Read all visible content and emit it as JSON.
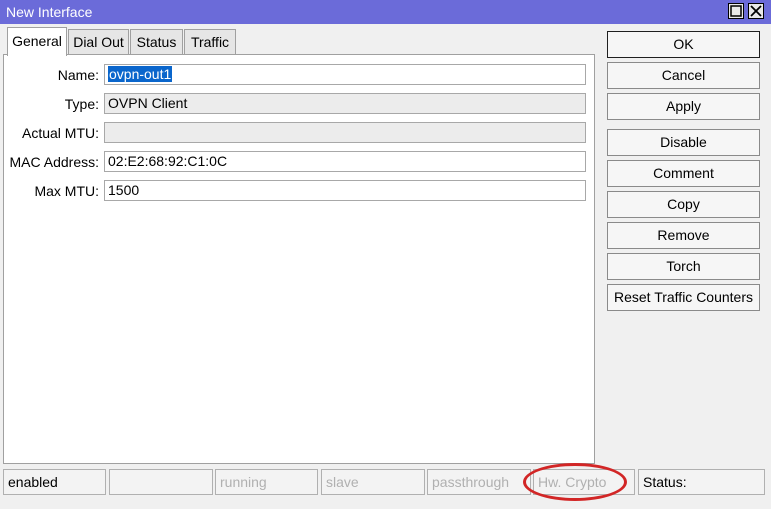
{
  "window": {
    "title": "New Interface",
    "maximize_icon": "maximize-icon",
    "close_icon": "close-icon"
  },
  "tabs": [
    {
      "label": "General",
      "active": true
    },
    {
      "label": "Dial Out",
      "active": false
    },
    {
      "label": "Status",
      "active": false
    },
    {
      "label": "Traffic",
      "active": false
    }
  ],
  "form": {
    "name": {
      "label": "Name:",
      "value": "ovpn-out1"
    },
    "type": {
      "label": "Type:",
      "value": "OVPN Client"
    },
    "actual_mtu": {
      "label": "Actual MTU:",
      "value": ""
    },
    "mac_address": {
      "label": "MAC Address:",
      "value": "02:E2:68:92:C1:0C"
    },
    "max_mtu": {
      "label": "Max MTU:",
      "value": "1500"
    }
  },
  "buttons": {
    "ok": "OK",
    "cancel": "Cancel",
    "apply": "Apply",
    "disable": "Disable",
    "comment": "Comment",
    "copy": "Copy",
    "remove": "Remove",
    "torch": "Torch",
    "reset_traffic_counters": "Reset Traffic Counters"
  },
  "statusbar": {
    "enabled": "enabled",
    "blank": "",
    "running": "running",
    "slave": "slave",
    "passthrough": "passthrough",
    "hw_crypto": "Hw. Crypto",
    "status": "Status:"
  },
  "colors": {
    "titlebar": "#6b6bd9",
    "selection": "#0a66cc",
    "annotation": "#d22626"
  }
}
